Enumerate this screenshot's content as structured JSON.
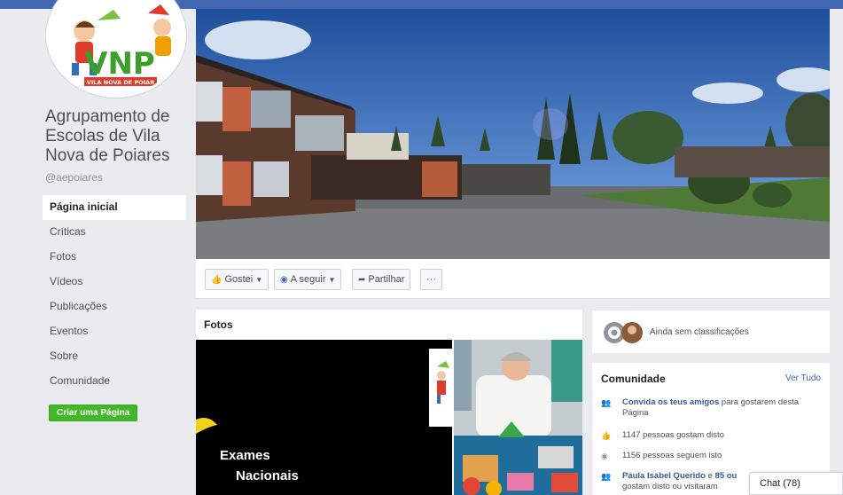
{
  "page": {
    "name": "Agrupamento de Escolas de Vila Nova de Poiares",
    "handle": "@aepoiares",
    "logo_text": "VNP",
    "logo_subtext": "VILA NOVA DE POIAR"
  },
  "nav": {
    "items": [
      {
        "label": "Página inicial",
        "active": true
      },
      {
        "label": "Críticas"
      },
      {
        "label": "Fotos"
      },
      {
        "label": "Vídeos"
      },
      {
        "label": "Publicações"
      },
      {
        "label": "Eventos"
      },
      {
        "label": "Sobre"
      },
      {
        "label": "Comunidade"
      }
    ],
    "create_page": "Criar uma Página"
  },
  "actions": {
    "like": "Gostei",
    "follow": "A seguir",
    "share": "Partilhar",
    "more": "···"
  },
  "photos": {
    "title": "Fotos",
    "photo1_line1": "Exames",
    "photo1_line2": "Nacionais"
  },
  "ratings": {
    "text": "Ainda sem classificações"
  },
  "community": {
    "title": "Comunidade",
    "see_all": "Ver Tudo",
    "invite_link": "Convida os teus amigos",
    "invite_rest": " para gostarem desta Página",
    "likes": "1147 pessoas gostam disto",
    "follows": "1156 pessoas seguem isto",
    "friends_link": "Paula Isabel Querido",
    "friends_mid": " e ",
    "friends_link2": "85 ou",
    "friends_rest": "gostam disto ou visitaram"
  },
  "chat": {
    "label": "Chat (78)"
  },
  "colors": {
    "brand": "#4267b2",
    "create_button": "#42b72a",
    "link": "#365899",
    "background": "#e9ebee"
  }
}
